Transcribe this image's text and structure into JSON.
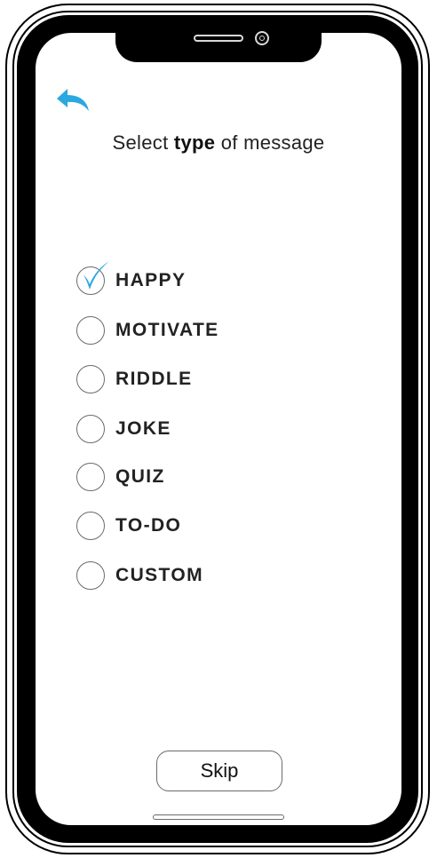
{
  "header": {
    "title_prefix": "Select ",
    "title_bold": "type",
    "title_suffix": " of message"
  },
  "options": [
    {
      "label": "HAPPY",
      "selected": true
    },
    {
      "label": "MOTIVATE",
      "selected": false
    },
    {
      "label": "RIDDLE",
      "selected": false
    },
    {
      "label": "JOKE",
      "selected": false
    },
    {
      "label": "QUIZ",
      "selected": false
    },
    {
      "label": "TO-DO",
      "selected": false
    },
    {
      "label": "CUSTOM",
      "selected": false
    }
  ],
  "footer": {
    "skip_label": "Skip"
  },
  "icons": {
    "back": "back-arrow-icon",
    "check": "checkmark-icon"
  },
  "colors": {
    "accent": "#2aa8e0",
    "text": "#222222",
    "bezel": "#000000"
  }
}
